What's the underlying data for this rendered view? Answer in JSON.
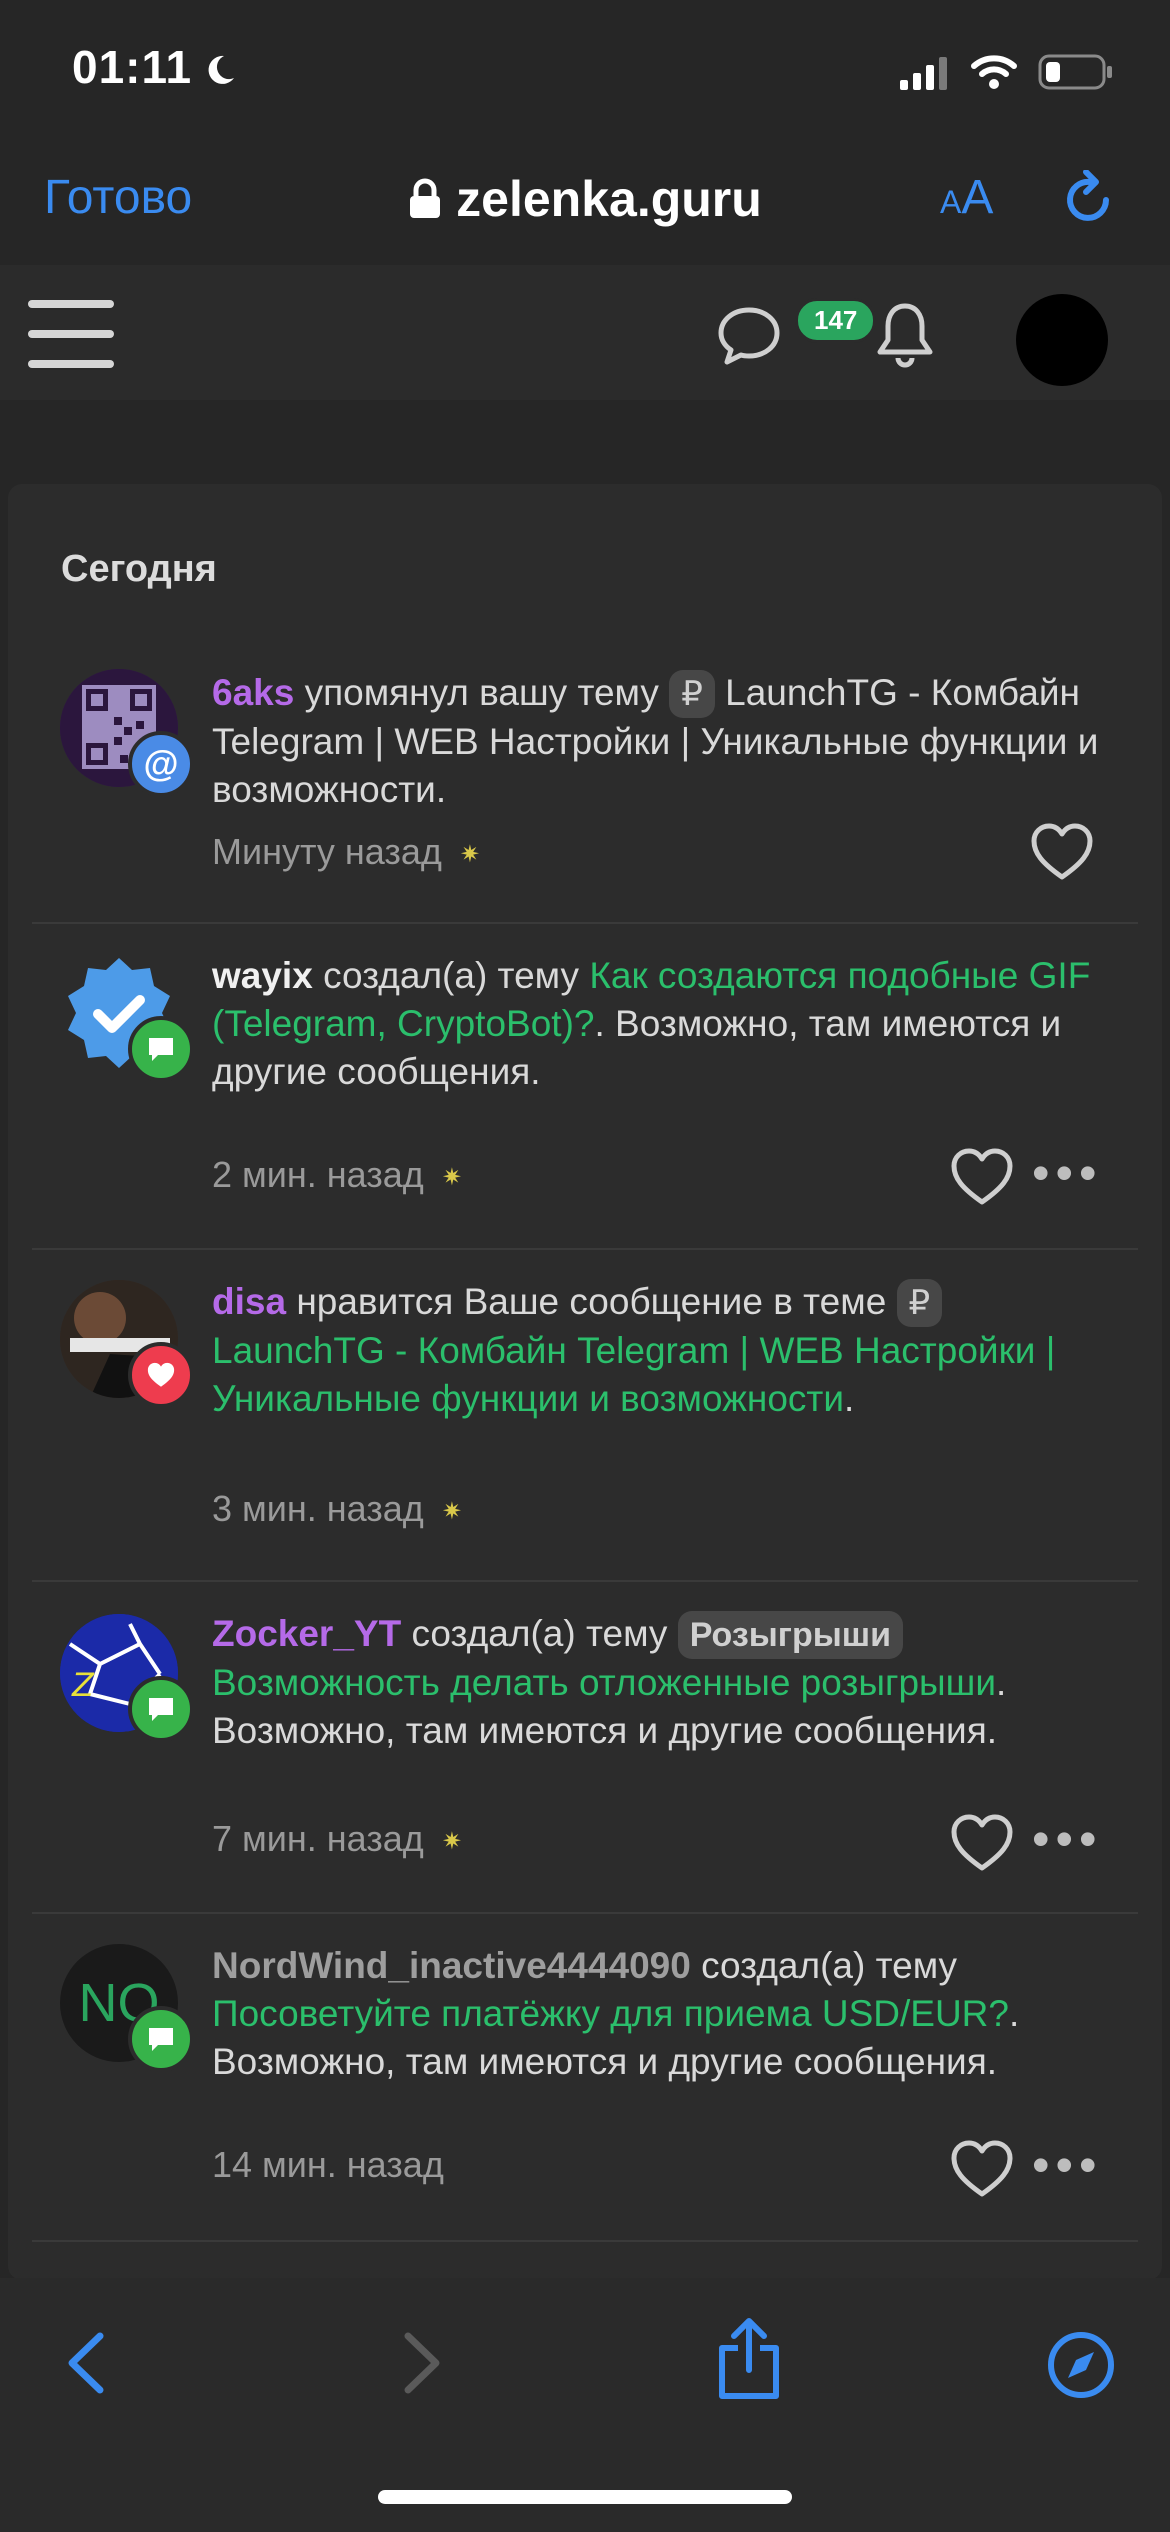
{
  "status_bar": {
    "time": "01:11"
  },
  "browser": {
    "done_label": "Готово",
    "url": "zelenka.guru",
    "text_size_label": "AA"
  },
  "site_header": {
    "messages_badge": "147"
  },
  "notifications": {
    "section_title": "Сегодня",
    "items": [
      {
        "user": "6aks",
        "action": " упомянул вашу тему ",
        "tag": "₽",
        "topic": " LaunchTG - Комбайн Telegram | WEB Настройки | Уникальные функции и возможности.",
        "time": "Минуту назад"
      },
      {
        "user": "wayix",
        "action": " создал(а) тему ",
        "topic": "Как создаются подобные GIF (Telegram, CryptoBot)?",
        "suffix": ". Возможно, там имеются и другие сообщения.",
        "time": "2 мин. назад"
      },
      {
        "user": "disa",
        "action": " нравится Ваше сообщение в теме ",
        "tag": "₽",
        "topic": "LaunchTG - Комбайн Telegram | WEB Настройки | Уникальные функции и возможности",
        "suffix": ".",
        "time": "3 мин. назад"
      },
      {
        "user": "Zocker_YT",
        "action": " создал(а) тему ",
        "tag": "Розыгрыши",
        "topic": "Возможность делать отложенные розыгрыши",
        "suffix": ". Возможно, там имеются и другие сообщения.",
        "time": "7 мин. назад"
      },
      {
        "user": "NordWind_inactive4444090",
        "avatar_text": "NO",
        "action": " создал(а) тему ",
        "topic": "Посоветуйте платёжку для приема USD/EUR?",
        "suffix": ". Возможно, там имеются и другие сообщения.",
        "time": "14 мин. назад"
      }
    ]
  },
  "colors": {
    "accent_blue": "#3a8bf0",
    "link_green": "#2bbf6c",
    "user_purple": "#b56ae8",
    "badge_green": "#2aa55e"
  }
}
